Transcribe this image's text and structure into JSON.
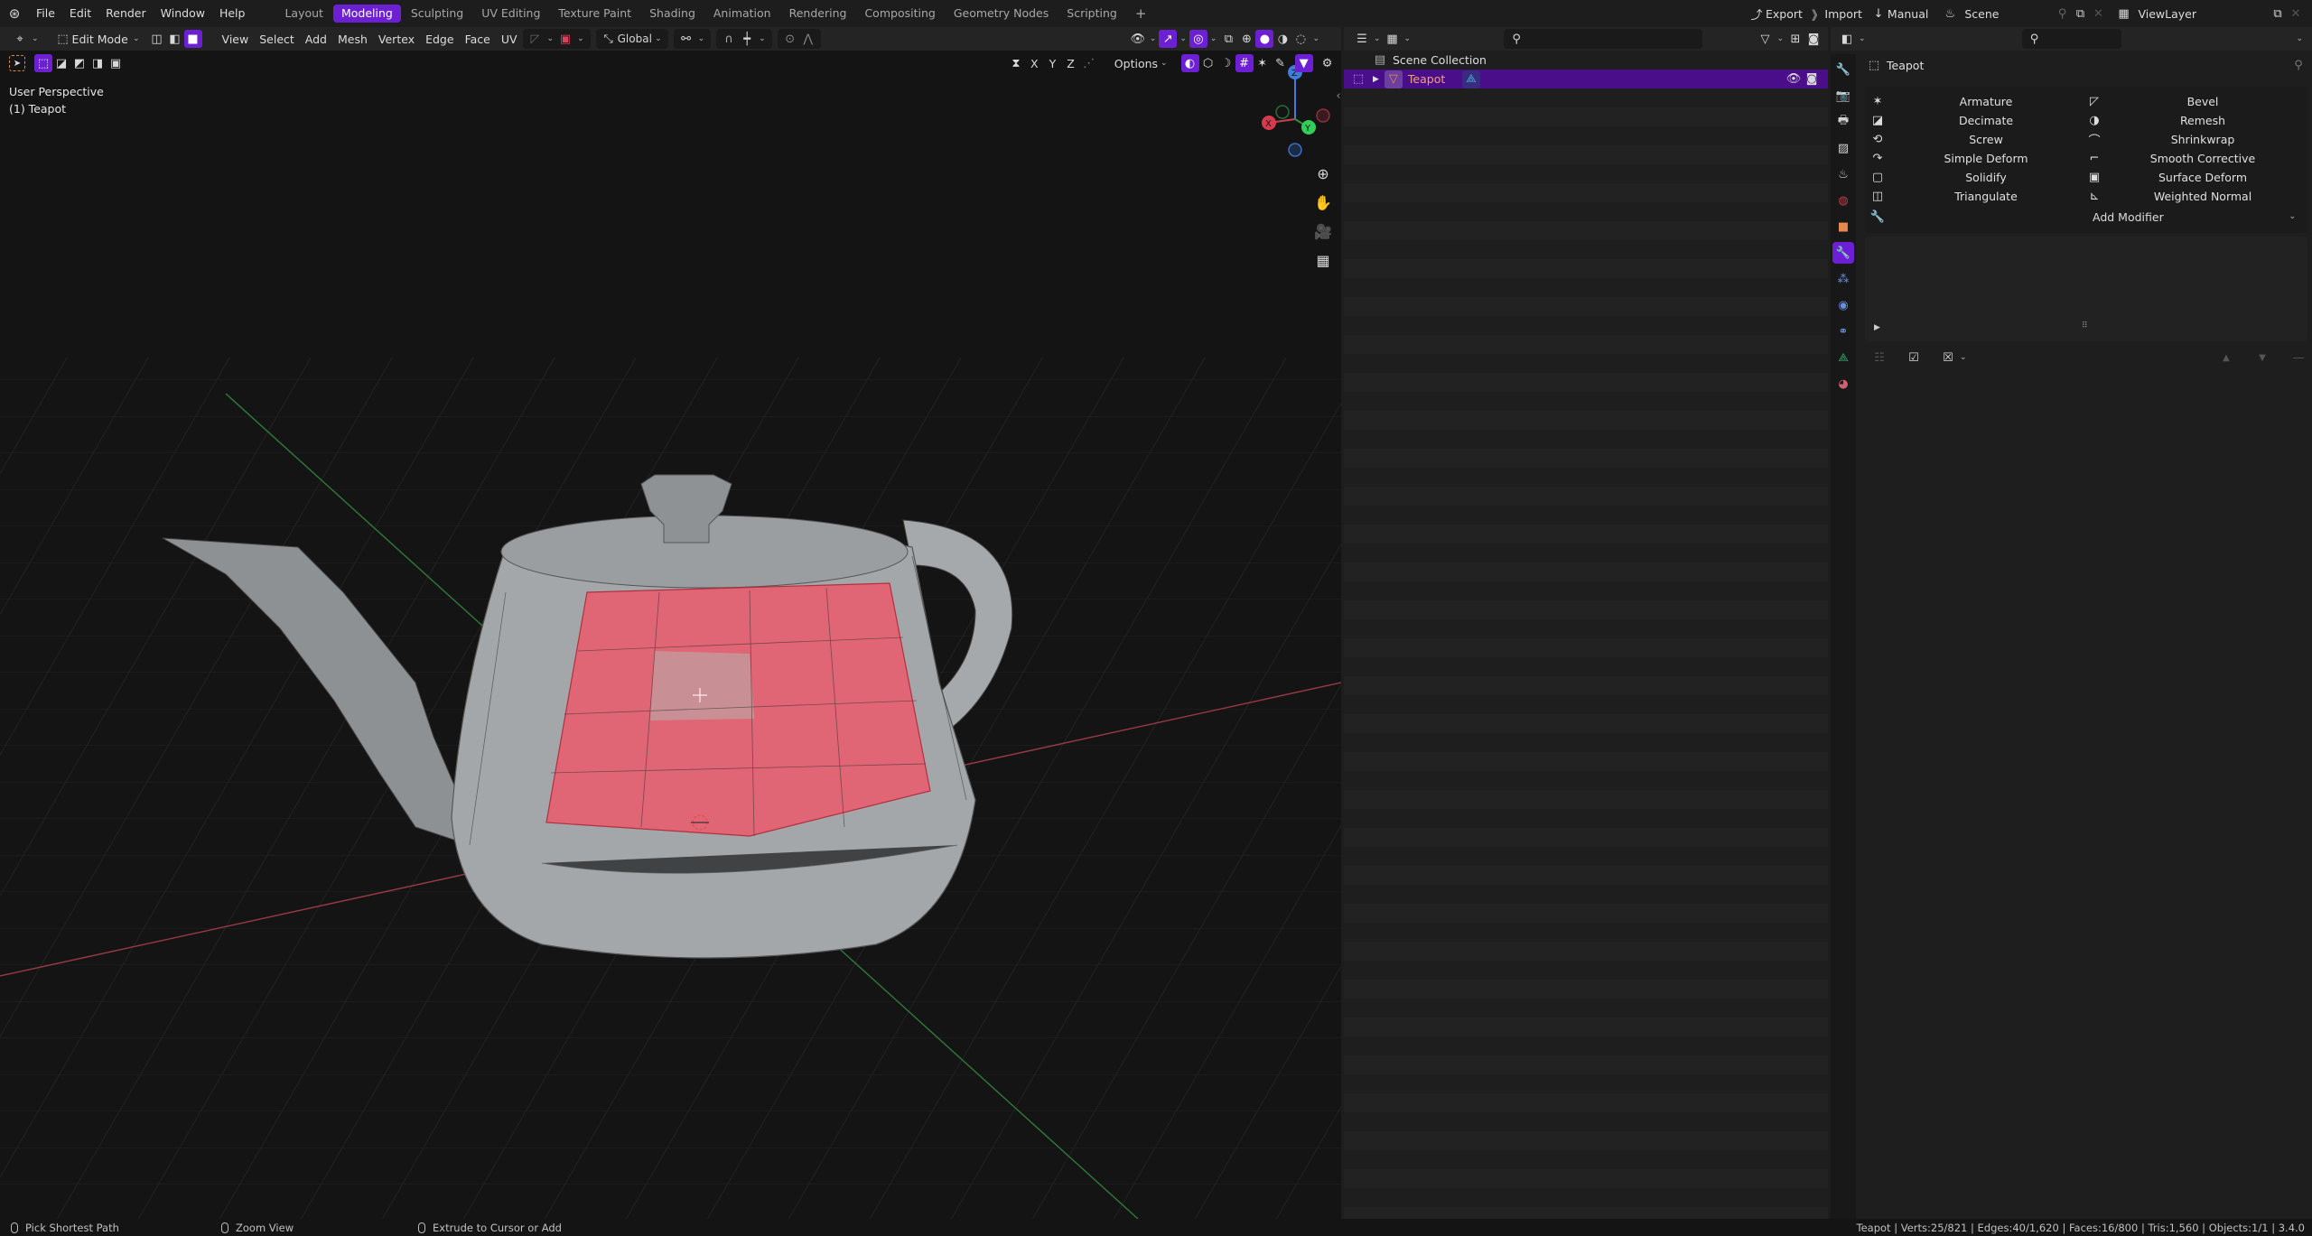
{
  "app": {
    "name": "Blender",
    "version": "3.4.0"
  },
  "menubar": {
    "items": [
      "File",
      "Edit",
      "Render",
      "Window",
      "Help"
    ]
  },
  "workspaces": {
    "tabs": [
      "Layout",
      "Modeling",
      "Sculpting",
      "UV Editing",
      "Texture Paint",
      "Shading",
      "Animation",
      "Rendering",
      "Compositing",
      "Geometry Nodes",
      "Scripting"
    ],
    "active": "Modeling",
    "add": "+"
  },
  "topright": {
    "export": "Export",
    "import": "Import",
    "manual": "Manual",
    "scene": "Scene",
    "viewlayer": "ViewLayer"
  },
  "viewport_header": {
    "mode": "Edit Mode",
    "menus": [
      "View",
      "Select",
      "Add",
      "Mesh",
      "Vertex",
      "Edge",
      "Face",
      "UV"
    ],
    "orientation": "Global"
  },
  "viewport_tool_header": {
    "axes": [
      "X",
      "Y",
      "Z"
    ],
    "options": "Options"
  },
  "viewport": {
    "view_name": "User Perspective",
    "object_label": "(1) Teapot",
    "gizmo": {
      "x": "X",
      "y": "Y",
      "z": "Z"
    },
    "colors": {
      "selected_face": "#e06575",
      "mesh": "#a4a7aa",
      "grid": "#2a2a2a",
      "x_axis": "#c8424f",
      "y_axis": "#3a8b3a"
    }
  },
  "outliner": {
    "search_placeholder": "",
    "root": "Scene Collection",
    "items": [
      {
        "name": "Teapot",
        "selected": true
      }
    ]
  },
  "properties": {
    "object_name": "Teapot",
    "modifiers_left": [
      "Armature",
      "Decimate",
      "Screw",
      "Simple Deform",
      "Solidify",
      "Triangulate"
    ],
    "modifiers_right": [
      "Bevel",
      "Remesh",
      "Shrinkwrap",
      "Smooth Corrective",
      "Surface Deform",
      "Weighted Normal"
    ],
    "add_modifier": "Add Modifier"
  },
  "statusbar": {
    "hints": [
      "Pick Shortest Path",
      "Zoom View",
      "Extrude to Cursor or Add"
    ],
    "stats": "Teapot | Verts:25/821 | Edges:40/1,620 | Faces:16/800 | Tris:1,560 | Objects:1/1 | 3.4.0"
  },
  "accent": "#6d1fd4"
}
